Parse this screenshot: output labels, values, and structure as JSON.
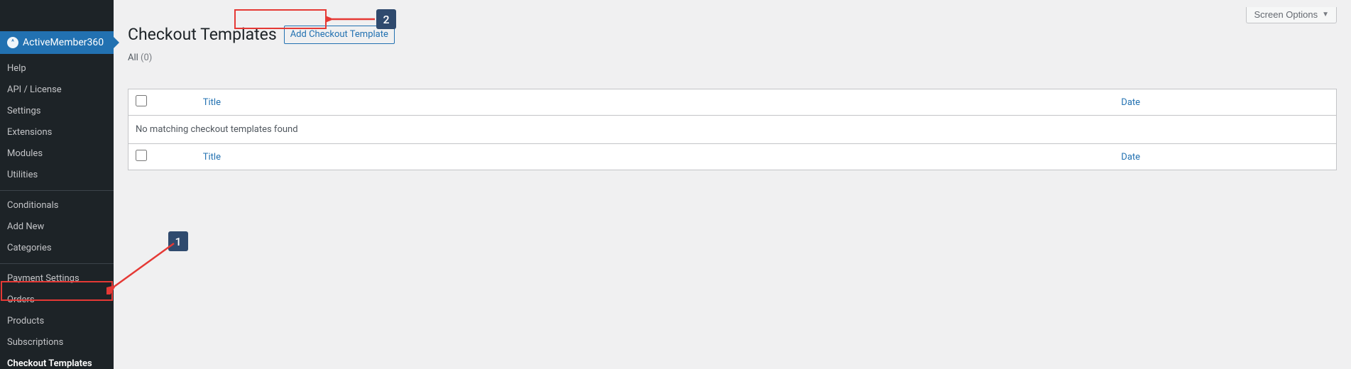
{
  "screen_options": {
    "label": "Screen Options"
  },
  "sidebar": {
    "plugin_name": "ActiveMember360",
    "logo_glyph": "^",
    "groups": [
      [
        "Help",
        "API / License",
        "Settings",
        "Extensions",
        "Modules",
        "Utilities"
      ],
      [
        "Conditionals",
        "Add New",
        "Categories"
      ],
      [
        "Payment Settings",
        "Orders",
        "Products",
        "Subscriptions",
        "Checkout Templates"
      ]
    ],
    "current": "Checkout Templates"
  },
  "page": {
    "title": "Checkout Templates",
    "add_button_label": "Add Checkout Template"
  },
  "filter": {
    "all_label": "All",
    "all_count": "(0)"
  },
  "table": {
    "title_header": "Title",
    "date_header": "Date",
    "empty_message": "No matching checkout templates found"
  },
  "annotations": {
    "step1": "1",
    "step2": "2"
  }
}
